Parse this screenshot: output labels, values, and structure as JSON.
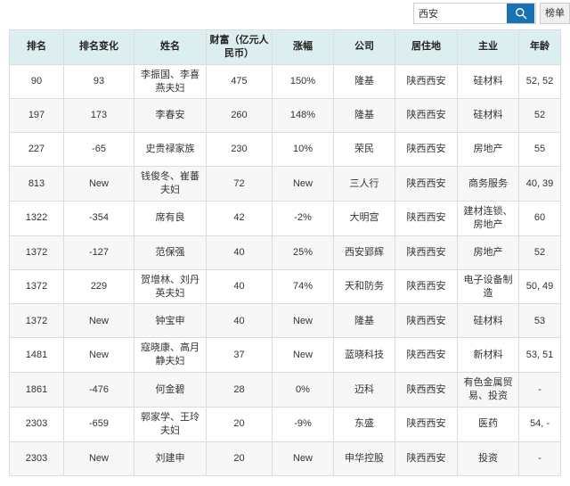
{
  "search": {
    "value": "西安",
    "placeholder": "",
    "search_icon": "search-icon",
    "rank_button_label": "榜单"
  },
  "table": {
    "columns": [
      "排名",
      "排名变化",
      "姓名",
      "财富（亿元人民币）",
      "涨幅",
      "公司",
      "居住地",
      "主业",
      "年龄"
    ],
    "rows": [
      {
        "rank": "90",
        "rank_change": "93",
        "name": "李振国、李喜燕夫妇",
        "wealth": "475",
        "growth": "150%",
        "company": "隆基",
        "residence": "陕西西安",
        "industry": "硅材料",
        "age": "52, 52"
      },
      {
        "rank": "197",
        "rank_change": "173",
        "name": "李春安",
        "wealth": "260",
        "growth": "148%",
        "company": "隆基",
        "residence": "陕西西安",
        "industry": "硅材料",
        "age": "52"
      },
      {
        "rank": "227",
        "rank_change": "-65",
        "name": "史贵禄家族",
        "wealth": "230",
        "growth": "10%",
        "company": "荣民",
        "residence": "陕西西安",
        "industry": "房地产",
        "age": "55"
      },
      {
        "rank": "813",
        "rank_change": "New",
        "name": "钱俊冬、崔蕃夫妇",
        "wealth": "72",
        "growth": "New",
        "company": "三人行",
        "residence": "陕西西安",
        "industry": "商务服务",
        "age": "40, 39"
      },
      {
        "rank": "1322",
        "rank_change": "-354",
        "name": "席有良",
        "wealth": "42",
        "growth": "-2%",
        "company": "大明宫",
        "residence": "陕西西安",
        "industry": "建材连锁、房地产",
        "age": "60"
      },
      {
        "rank": "1372",
        "rank_change": "-127",
        "name": "范保强",
        "wealth": "40",
        "growth": "25%",
        "company": "西安郢辉",
        "residence": "陕西西安",
        "industry": "房地产",
        "age": "52"
      },
      {
        "rank": "1372",
        "rank_change": "229",
        "name": "贺增林、刘丹英夫妇",
        "wealth": "40",
        "growth": "74%",
        "company": "天和防务",
        "residence": "陕西西安",
        "industry": "电子设备制造",
        "age": "50, 49"
      },
      {
        "rank": "1372",
        "rank_change": "New",
        "name": "钟宝申",
        "wealth": "40",
        "growth": "New",
        "company": "隆基",
        "residence": "陕西西安",
        "industry": "硅材料",
        "age": "53"
      },
      {
        "rank": "1481",
        "rank_change": "New",
        "name": "寇晓康、高月静夫妇",
        "wealth": "37",
        "growth": "New",
        "company": "蓝晓科技",
        "residence": "陕西西安",
        "industry": "新材料",
        "age": "53, 51"
      },
      {
        "rank": "1861",
        "rank_change": "-476",
        "name": "何金碧",
        "wealth": "28",
        "growth": "0%",
        "company": "迈科",
        "residence": "陕西西安",
        "industry": "有色金属贸易、投资",
        "age": "-"
      },
      {
        "rank": "2303",
        "rank_change": "-659",
        "name": "郭家学、王玲夫妇",
        "wealth": "20",
        "growth": "-9%",
        "company": "东盛",
        "residence": "陕西西安",
        "industry": "医药",
        "age": "54, -"
      },
      {
        "rank": "2303",
        "rank_change": "New",
        "name": "刘建申",
        "wealth": "20",
        "growth": "New",
        "company": "申华控股",
        "residence": "陕西西安",
        "industry": "投资",
        "age": "-"
      }
    ]
  },
  "colors": {
    "header_bg": "#dceef0",
    "search_button_bg": "#1b72b3",
    "row_alt_bg": "#f7f7f7",
    "border": "#dcdcdc"
  }
}
